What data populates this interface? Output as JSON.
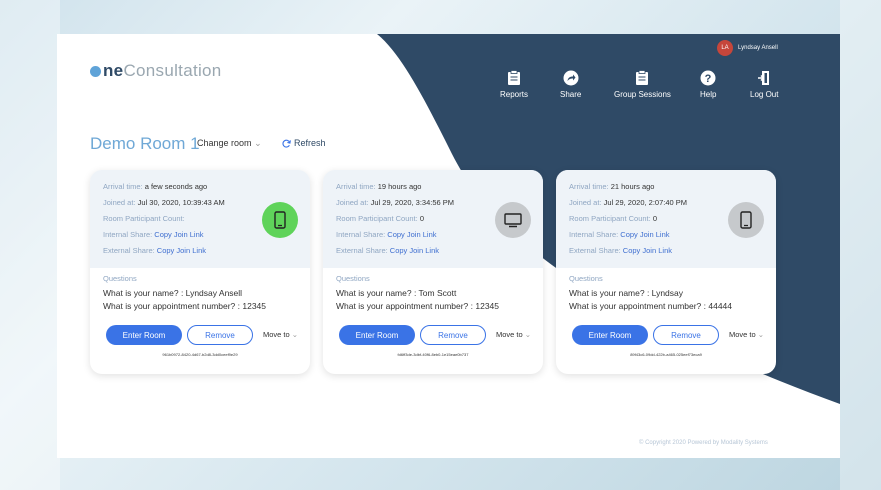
{
  "app": {
    "logo_prefix": "ne",
    "logo_suffix": "Consultation",
    "user_initials": "LA",
    "user_name": "Lyndsay Ansell"
  },
  "nav": [
    {
      "label": "Reports",
      "icon": "clipboard-icon"
    },
    {
      "label": "Share",
      "icon": "share-icon"
    },
    {
      "label": "Group Sessions",
      "icon": "group-sessions-icon"
    },
    {
      "label": "Help",
      "icon": "help-icon"
    },
    {
      "label": "Log Out",
      "icon": "logout-icon"
    }
  ],
  "room": {
    "title": "Demo Room 1",
    "change_label": "Change room",
    "refresh_label": "Refresh"
  },
  "card_labels": {
    "arrival": "Arrival time:",
    "joined": "Joined at:",
    "participant_count": "Room Participant Count:",
    "internal": "Internal Share:",
    "external": "External Share:",
    "copy_link": "Copy Join Link",
    "questions": "Questions",
    "enter": "Enter Room",
    "remove": "Remove",
    "move_to": "Move to"
  },
  "cards": [
    {
      "arrival": "a few seconds ago",
      "joined": "Jul 30, 2020, 10:39:43 AM",
      "participant_count": "",
      "q1": "What is your name? : Lyndsay Ansell",
      "q2": "What is your appointment number? : 12345",
      "guid": "961b0972-8420-4d67-b2d8-3dd0ceef9e29",
      "device": "phone-icon",
      "device_color": "#5fd35a"
    },
    {
      "arrival": "19 hours ago",
      "joined": "Jul 29, 2020, 3:34:56 PM",
      "participant_count": "0",
      "q1": "What is your name? : Tom Scott",
      "q2": "What is your appointment number? : 12345",
      "guid": "fd6ff3de-3dbf-40f6-8eb0-1e15eae0b737",
      "device": "monitor-icon",
      "device_color": "#c6c9cc"
    },
    {
      "arrival": "21 hours ago",
      "joined": "Jul 29, 2020, 2:07:40 PM",
      "participant_count": "0",
      "q1": "What is your name? : Lyndsay",
      "q2": "What is your appointment number? : 44444",
      "guid": "89f43c6-09dd-422b-a465-025eef73eca9",
      "device": "phone-icon",
      "device_color": "#c6c9cc"
    }
  ],
  "footer": "© Copyright 2020 Powered by Modality Systems",
  "colors": {
    "navy": "#2f4a66",
    "accent": "#3a73e6"
  }
}
